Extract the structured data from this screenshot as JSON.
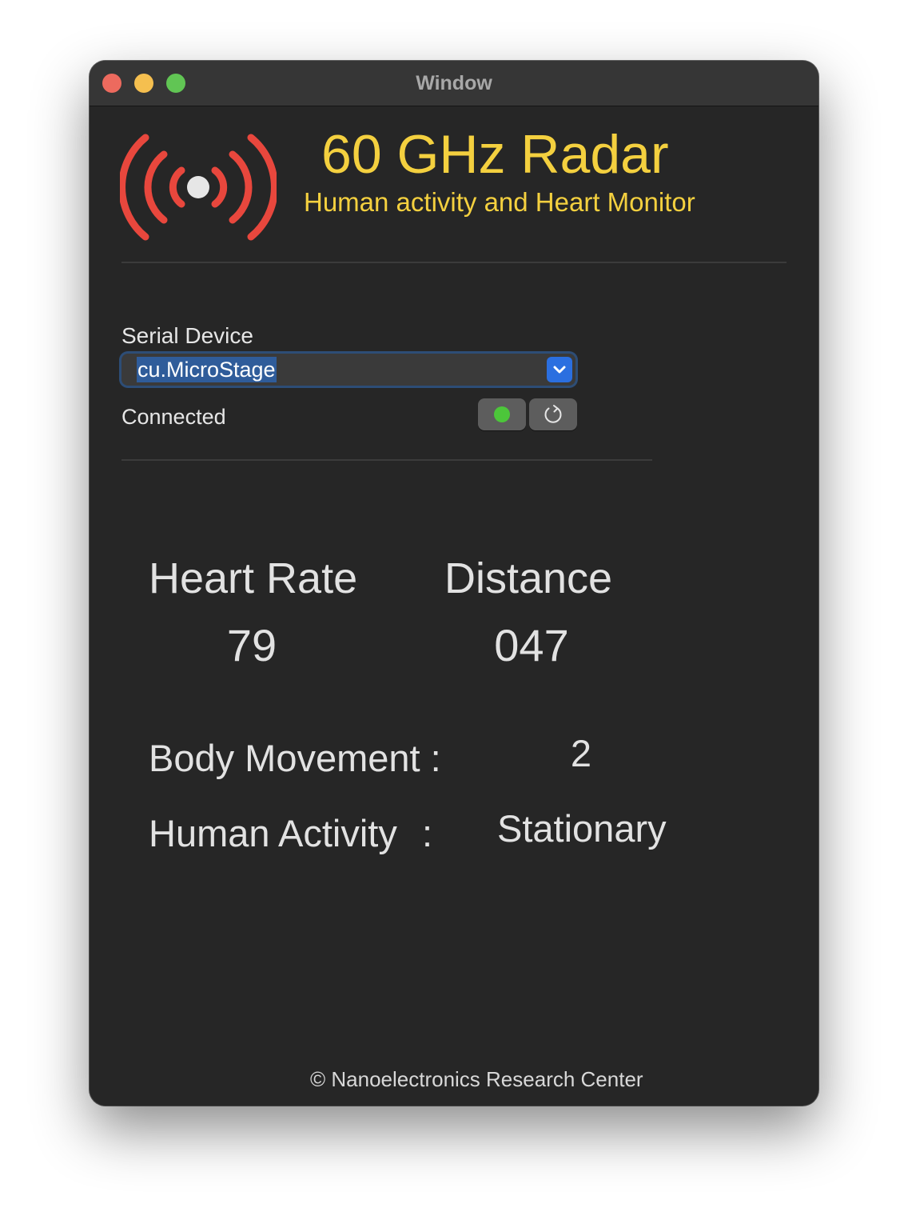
{
  "window": {
    "title": "Window"
  },
  "header": {
    "title": "60 GHz Radar",
    "subtitle": "Human activity and Heart Monitor",
    "logo_icon": "radar-signal-icon",
    "accent_color": "#f4d03f",
    "logo_color": "#e8473d"
  },
  "serial": {
    "label": "Serial Device",
    "selected": "cu.MicroStage",
    "status": "Connected",
    "status_color": "#4cc63a",
    "refresh_icon": "refresh-icon"
  },
  "metrics": {
    "heart_rate_label": "Heart Rate",
    "heart_rate_value": "79",
    "distance_label": "Distance",
    "distance_value": "047",
    "body_movement_label": "Body Movement :",
    "body_movement_value": "2",
    "human_activity_label": "Human Activity",
    "human_activity_colon": ":",
    "human_activity_value": "Stationary"
  },
  "footer": {
    "text": "© Nanoelectronics Research Center"
  }
}
